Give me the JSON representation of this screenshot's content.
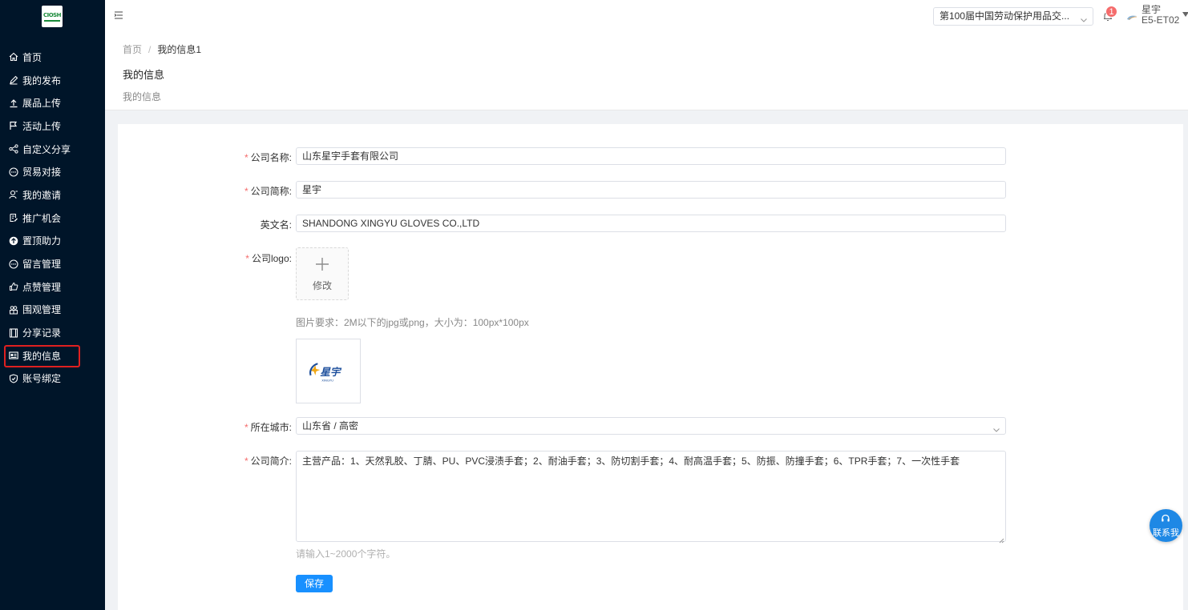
{
  "logo": {
    "text": "CIOSH"
  },
  "sidebar": {
    "items": [
      {
        "label": "首页",
        "icon": "home-icon"
      },
      {
        "label": "我的发布",
        "icon": "edit-icon"
      },
      {
        "label": "展品上传",
        "icon": "upload-icon"
      },
      {
        "label": "活动上传",
        "icon": "flag-icon"
      },
      {
        "label": "自定义分享",
        "icon": "share-icon"
      },
      {
        "label": "贸易对接",
        "icon": "chat-icon"
      },
      {
        "label": "我的邀请",
        "icon": "invite-icon"
      },
      {
        "label": "推广机会",
        "icon": "promote-icon"
      },
      {
        "label": "置顶助力",
        "icon": "top-icon"
      },
      {
        "label": "留言管理",
        "icon": "message-icon"
      },
      {
        "label": "点赞管理",
        "icon": "like-icon"
      },
      {
        "label": "围观管理",
        "icon": "watch-icon"
      },
      {
        "label": "分享记录",
        "icon": "record-icon"
      },
      {
        "label": "我的信息",
        "icon": "id-card-icon",
        "active": true
      },
      {
        "label": "账号绑定",
        "icon": "shield-icon"
      }
    ]
  },
  "header": {
    "expo_select": "第100届中国劳动保护用品交...",
    "notification_count": "1",
    "user_name": "星宇",
    "user_id": "E5-ET02"
  },
  "breadcrumb": {
    "home": "首页",
    "separator": "/",
    "current": "我的信息1"
  },
  "page": {
    "title": "我的信息",
    "subtitle": "我的信息"
  },
  "form": {
    "company_name": {
      "label": "公司名称:",
      "value": "山东星宇手套有限公司",
      "required": true
    },
    "company_short": {
      "label": "公司简称:",
      "value": "星宇",
      "required": true
    },
    "english_name": {
      "label": "英文名:",
      "value": "SHANDONG XINGYU GLOVES CO.,LTD",
      "required": false
    },
    "logo": {
      "label": "公司logo:",
      "upload_text": "修改",
      "hint": "图片要求：2M以下的jpg或png，大小为：100px*100px",
      "preview_text": "星宇",
      "preview_subtext": "XINGYU",
      "required": true
    },
    "city": {
      "label": "所在城市:",
      "value": "山东省 / 高密",
      "required": true
    },
    "intro": {
      "label": "公司简介:",
      "value": "主营产品：1、天然乳胶、丁腈、PU、PVC浸渍手套；2、耐油手套；3、防切割手套；4、耐高温手套；5、防振、防撞手套；6、TPR手套；7、一次性手套",
      "hint": "请输入1~2000个字符。",
      "required": true
    },
    "save_label": "保存"
  },
  "contact": {
    "label": "联系我"
  },
  "colors": {
    "sidebar_bg": "#001529",
    "primary": "#1890ff",
    "required": "#f56c6c",
    "active_outline": "#e02020"
  }
}
